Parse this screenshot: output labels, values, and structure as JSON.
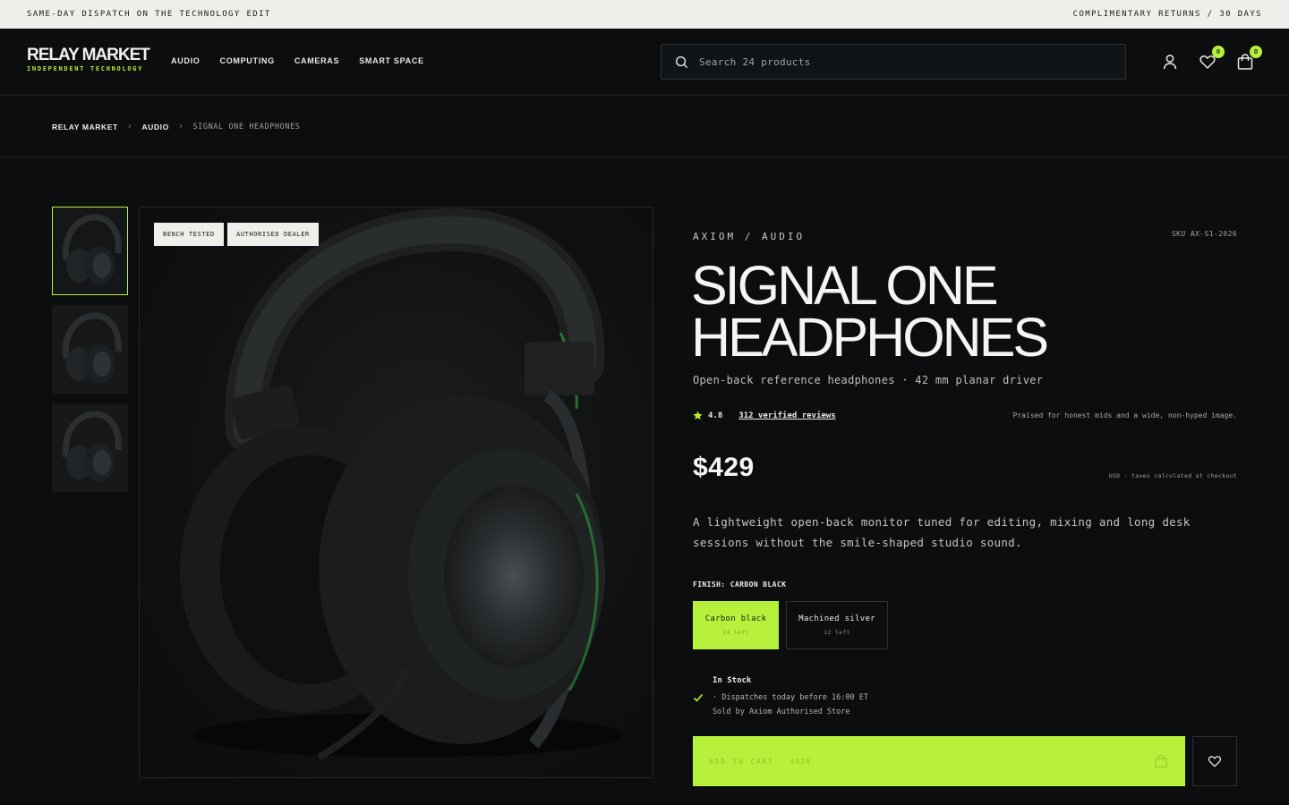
{
  "topbar": {
    "left": "SAME-DAY DISPATCH ON THE TECHNOLOGY EDIT",
    "right": "COMPLIMENTARY RETURNS / 30 DAYS"
  },
  "header": {
    "logo": "RELAY MARKET",
    "logo_sub": "INDEPENDENT TECHNOLOGY",
    "nav": [
      "AUDIO",
      "COMPUTING",
      "CAMERAS",
      "SMART SPACE"
    ],
    "search_placeholder": "Search 24 products",
    "wishlist_count": "0",
    "cart_count": "0"
  },
  "breadcrumb": [
    "RELAY MARKET",
    "AUDIO",
    "SIGNAL ONE HEADPHONES"
  ],
  "gallery": {
    "tags": [
      "BENCH TESTED",
      "AUTHORISED DEALER"
    ],
    "thumbnails": 3
  },
  "product": {
    "brand": "AXIOM / AUDIO",
    "sku": "SKU AX-S1-2026",
    "title_line1": "SIGNAL ONE",
    "title_line2": "HEADPHONES",
    "subtitle": "Open-back reference headphones · 42 mm planar driver",
    "rating": "4.8",
    "reviews": "312 verified reviews",
    "praise": "Praised for honest mids and a wide, non-hyped image.",
    "price": "$429",
    "taxes": "USD · taxes calculated at checkout",
    "description": "A lightweight open-back monitor tuned for editing, mixing and long desk sessions without the smile-shaped studio sound.",
    "finish_label": "FINISH: CARBON BLACK",
    "options": [
      {
        "name": "Carbon black",
        "stock": "14 left"
      },
      {
        "name": "Machined silver",
        "stock": "12 left"
      }
    ],
    "stock_status": "In Stock",
    "dispatch": "· Dispatches today before 16:00 ET",
    "seller": "Sold by Axiom Authorised Store",
    "add_to_cart": "ADD TO CART",
    "cart_price": "$429"
  },
  "colors": {
    "accent": "#b7f13b",
    "background": "#0b0d0e",
    "topbar": "#eeefea"
  }
}
